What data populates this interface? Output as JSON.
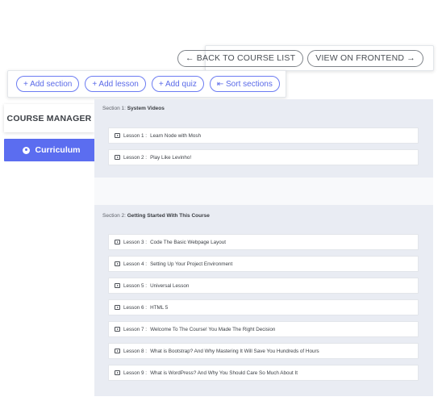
{
  "header": {
    "back_label": "← BACK TO COURSE LIST",
    "frontend_label": "VIEW ON FRONTEND →"
  },
  "toolbar": {
    "add_section": "+ Add section",
    "add_lesson": "+ Add lesson",
    "add_quiz": "+ Add quiz",
    "sort_sections": "⇤ Sort sections"
  },
  "sidebar": {
    "title": "COURSE MANAGER",
    "active_item": "Curriculum"
  },
  "sections": [
    {
      "prefix": "Section 1:",
      "title": "System Videos",
      "lessons": [
        {
          "prefix": "Lesson 1 :",
          "name": "Learn Node with Mosh"
        },
        {
          "prefix": "Lesson 2 :",
          "name": "Play Like Levinho!"
        }
      ]
    },
    {
      "prefix": "Section 2:",
      "title": "Getting Started With This Course",
      "lessons": [
        {
          "prefix": "Lesson 3 :",
          "name": "Code The Basic Webpage Layout"
        },
        {
          "prefix": "Lesson 4 :",
          "name": "Setting Up Your Project Environment"
        },
        {
          "prefix": "Lesson 5 :",
          "name": "Universal Lesson"
        },
        {
          "prefix": "Lesson 6 :",
          "name": "HTML 5"
        },
        {
          "prefix": "Lesson 7 :",
          "name": "Welcome To The Course! You Made The Right Decision"
        },
        {
          "prefix": "Lesson 8 :",
          "name": "What is Bootstrap? And Why Mastering It Will Save You Hundreds of Hours"
        },
        {
          "prefix": "Lesson 9 :",
          "name": "What is WordPress? And Why You Should Care So Much About It"
        }
      ]
    }
  ]
}
